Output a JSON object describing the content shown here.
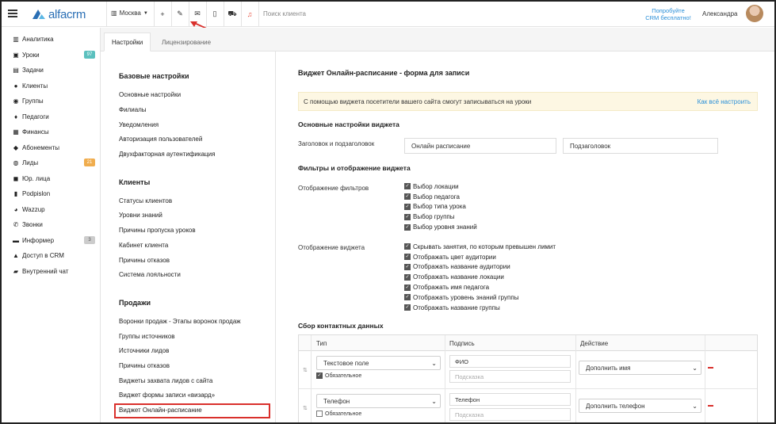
{
  "topbar": {
    "logo_text": "alfacrm",
    "city": "Москва",
    "search_placeholder": "Поиск клиента",
    "promo_line1": "Попробуйте",
    "promo_line2": "CRM бесплатно!",
    "username": "Александра",
    "accent_color": "#2a6fb5"
  },
  "nav": {
    "items": [
      {
        "label": "Аналитика",
        "icon": "chart-icon",
        "glyph": "▥"
      },
      {
        "label": "Уроки",
        "icon": "calendar-icon",
        "glyph": "▣",
        "badge": "97",
        "badge_color": "teal"
      },
      {
        "label": "Задачи",
        "icon": "tasks-icon",
        "glyph": "▤"
      },
      {
        "label": "Клиенты",
        "icon": "user-icon",
        "glyph": "●"
      },
      {
        "label": "Группы",
        "icon": "group-icon",
        "glyph": "◉"
      },
      {
        "label": "Педагоги",
        "icon": "teacher-icon",
        "glyph": "♦"
      },
      {
        "label": "Финансы",
        "icon": "money-icon",
        "glyph": "▦"
      },
      {
        "label": "Абонементы",
        "icon": "tag-icon",
        "glyph": "◆"
      },
      {
        "label": "Лиды",
        "icon": "leads-icon",
        "glyph": "◍",
        "badge": "21",
        "badge_color": "orange"
      },
      {
        "label": "Юр. лица",
        "icon": "building-icon",
        "glyph": "◼"
      },
      {
        "label": "Podpislon",
        "icon": "document-icon",
        "glyph": "▮"
      },
      {
        "label": "Wazzup",
        "icon": "whatsapp-icon",
        "glyph": "◕"
      },
      {
        "label": "Звонки",
        "icon": "phone-icon",
        "glyph": "✆"
      },
      {
        "label": "Информер",
        "icon": "inbox-icon",
        "glyph": "▬",
        "badge": "3",
        "badge_color": "gray"
      },
      {
        "label": "Доступ в CRM",
        "icon": "lock-icon",
        "glyph": "▲"
      },
      {
        "label": "Внутренний чат",
        "icon": "chat-icon",
        "glyph": "▰"
      }
    ]
  },
  "tabs": {
    "settings": "Настройки",
    "licensing": "Лицензирование"
  },
  "settings_menu": {
    "base_heading": "Базовые настройки",
    "base_links": [
      "Основные настройки",
      "Филиалы",
      "Уведомления",
      "Авторизация пользователей",
      "Двухфакторная аутентификация"
    ],
    "clients_heading": "Клиенты",
    "clients_links": [
      "Статусы клиентов",
      "Уровни знаний",
      "Причины пропуска уроков",
      "Кабинет клиента",
      "Причины отказов",
      "Система лояльности"
    ],
    "sales_heading": "Продажи",
    "sales_links": [
      "Воронки продаж - Этапы воронок продаж",
      "Группы источников",
      "Источники лидов",
      "Причины отказов",
      "Виджеты захвата лидов с сайта",
      "Виджет формы записи «визард»",
      "Виджет Онлайн-расписание"
    ]
  },
  "main": {
    "title": "Виджет Онлайн-расписание - форма для записи",
    "notice_text": "С помощью виджета посетители вашего сайта смогут записываться на уроки",
    "notice_link": "Как всё настроить",
    "basic_heading": "Основные настройки виджета",
    "header_label": "Заголовок и подзаголовок",
    "header_value": "Онлайн расписание",
    "subheader_value": "Подзаголовок",
    "filters_heading": "Фильтры и отображение виджета",
    "filters_label": "Отображение фильтров",
    "filters": [
      "Выбор локации",
      "Выбор педагога",
      "Выбор типа урока",
      "Выбор группы",
      "Выбор уровня знаний"
    ],
    "display_label": "Отображение виджета",
    "display_options": [
      "Скрывать занятия, по которым превышен лимит",
      "Отображать цвет аудитории",
      "Отображать название аудитории",
      "Отображать название локации",
      "Отображать имя педагога",
      "Отображать уровень знаний группы",
      "Отображать название группы"
    ],
    "contacts_heading": "Сбор контактных данных",
    "table": {
      "col_type": "Тип",
      "col_caption": "Подпись",
      "col_action": "Действие",
      "rows": [
        {
          "type": "Текстовое поле",
          "required_label": "Обязательное",
          "required": true,
          "caption": "ФИО",
          "hint": "Подсказка",
          "action": "Дополнить имя"
        },
        {
          "type": "Телефон",
          "required_label": "Обязательное",
          "required": false,
          "caption": "Телефон",
          "hint": "Подсказка",
          "action": "Дополнить телефон"
        }
      ]
    }
  }
}
